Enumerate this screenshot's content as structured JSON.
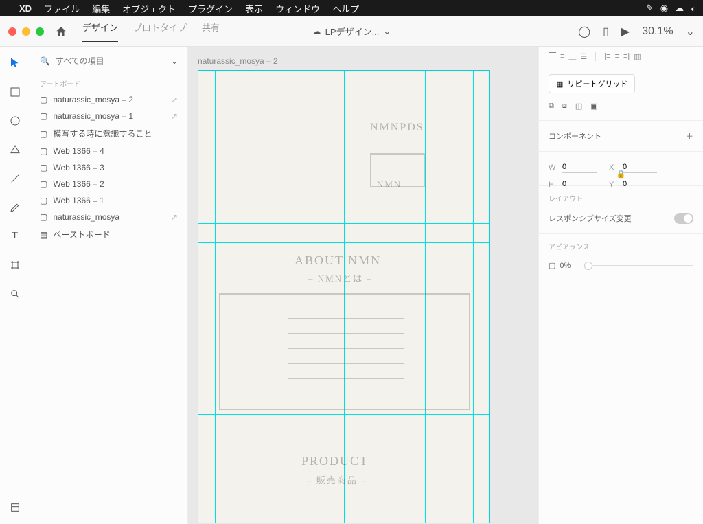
{
  "mac_menu": {
    "app": "XD",
    "items": [
      "ファイル",
      "編集",
      "オブジェクト",
      "プラグイン",
      "表示",
      "ウィンドウ",
      "ヘルプ"
    ]
  },
  "titlebar": {
    "tabs": {
      "design": "デザイン",
      "prototype": "プロトタイプ",
      "share": "共有"
    },
    "doc_title": "LPデザイン...",
    "zoom": "30.1%"
  },
  "sidebar": {
    "search_placeholder": "すべての項目",
    "section_label": "アートボード",
    "items": [
      {
        "label": "naturassic_mosya – 2",
        "ext": true
      },
      {
        "label": "naturassic_mosya – 1",
        "ext": true
      },
      {
        "label": "模写する時に意識すること",
        "ext": false
      },
      {
        "label": "Web 1366 – 4",
        "ext": false
      },
      {
        "label": "Web 1366 – 3",
        "ext": false
      },
      {
        "label": "Web 1366 – 2",
        "ext": false
      },
      {
        "label": "Web 1366 – 1",
        "ext": false
      },
      {
        "label": "naturassic_mosya",
        "ext": true
      },
      {
        "label": "ペーストボード",
        "ext": false
      }
    ]
  },
  "canvas": {
    "artboard_label": "naturassic_mosya – 2",
    "sketch": {
      "t1": "NMNPDS",
      "t2": "NMN",
      "t3": "ABOUT NMN",
      "t4": "– NMNとは –",
      "t5": "PRODUCT",
      "t6": "– 販売商品 –"
    }
  },
  "inspector": {
    "repeat_grid": "リピートグリッド",
    "component": "コンポーネント",
    "w": "0",
    "x": "0",
    "h": "0",
    "y": "0",
    "layout": "レイアウト",
    "responsive": "レスポンシブサイズ変更",
    "appearance": "アピアランス",
    "opacity": "0%"
  }
}
